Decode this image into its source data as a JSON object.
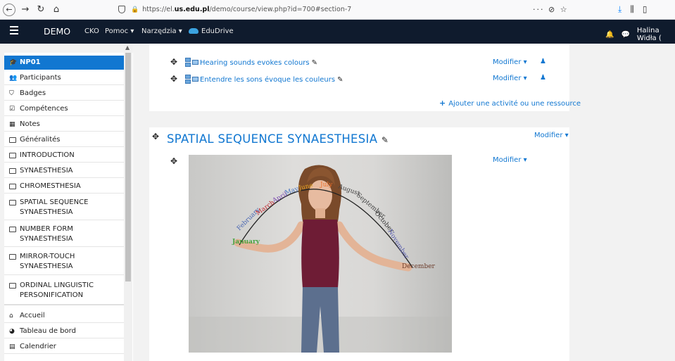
{
  "browser": {
    "url_prefix": "https://el.",
    "url_host": "us.edu.pl",
    "url_path": "/demo/course/view.php?id=700#section-7",
    "page_actions": "··· ⊘ ☆"
  },
  "navbar": {
    "brand": "DEMO",
    "links": {
      "cko": "CKO",
      "pomoc": "Pomoc",
      "narzedzia": "Narzędzia",
      "edudrive": "EduDrive"
    },
    "user_name": "Halina Widła ("
  },
  "sidebar": {
    "course": "NP01",
    "items": [
      "Participants",
      "Badges",
      "Compétences",
      "Notes",
      "Généralités",
      "INTRODUCTION",
      "SYNAESTHESIA",
      "CHROMESTHESIA"
    ],
    "multi": [
      {
        "l1": "SPATIAL SEQUENCE",
        "l2": "SYNAESTHESIA"
      },
      {
        "l1": "NUMBER FORM",
        "l2": "SYNAESTHESIA"
      },
      {
        "l1": "MIRROR-TOUCH",
        "l2": "SYNAESTHESIA"
      },
      {
        "l1": "ORDINAL LINGUISTIC",
        "l2": "PERSONIFICATION"
      }
    ],
    "bottom": [
      "Accueil",
      "Tableau de bord",
      "Calendrier"
    ]
  },
  "main": {
    "activities": [
      "Hearing sounds evokes colours",
      "Entendre les sons évoque les couleurs"
    ],
    "modifier_label": "Modifier",
    "add_activity": "Ajouter une activité ou une ressource",
    "section_title": "SPATIAL SEQUENCE SYNAESTHESIA",
    "months": [
      "January",
      "February",
      "March",
      "April",
      "May",
      "June",
      "July",
      "August",
      "September",
      "October",
      "November",
      "December"
    ]
  }
}
